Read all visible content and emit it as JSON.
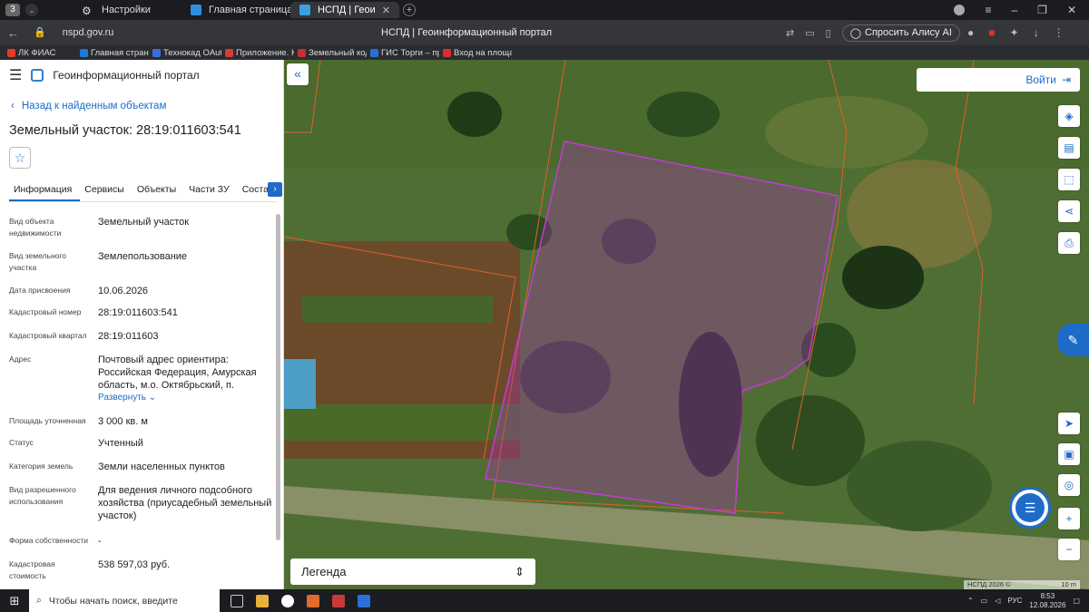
{
  "browser": {
    "workspace_badge": "3",
    "tabs": [
      {
        "label": "Настройки",
        "icon": "gear-icon"
      },
      {
        "label": "Главная страница",
        "icon": "site-favicon"
      },
      {
        "label": "НСПД | Геоинформаци",
        "icon": "nspd-favicon",
        "active": true
      }
    ],
    "url": "nspd.gov.ru",
    "page_title": "НСПД | Геоинформационный портал",
    "alice_button": "Спросить Алису AI",
    "bookmarks": [
      {
        "label": "ЛК ФИАС",
        "color": "#e03b2b"
      },
      {
        "label": "Главная страниц",
        "color": "#1d7ad9"
      },
      {
        "label": "Технокад OAuth",
        "color": "#3b6fd8"
      },
      {
        "label": "Приложение. Кла",
        "color": "#d83b3b"
      },
      {
        "label": "Земельный кодек",
        "color": "#c43030"
      },
      {
        "label": "ГИС Торги – прод",
        "color": "#2d6fd8"
      },
      {
        "label": "Вход на площадк",
        "color": "#d83030"
      }
    ]
  },
  "portal": {
    "title": "Геоинформационный портал",
    "back_link": "Назад к найденным объектам",
    "object_title": "Земельный участок: 28:19:011603:541",
    "tabs": [
      "Информация",
      "Сервисы",
      "Объекты",
      "Части ЗУ",
      "Состав"
    ],
    "fields": [
      {
        "key": "Вид объекта недвижимости",
        "value": "Земельный участок"
      },
      {
        "key": "Вид земельного участка",
        "value": "Землепользование"
      },
      {
        "key": "Дата присвоения",
        "value": "10.06.2026"
      },
      {
        "key": "Кадастровый номер",
        "value": "28:19:011603:541"
      },
      {
        "key": "Кадастровый квартал",
        "value": "28:19:011603"
      },
      {
        "key": "Адрес",
        "value": "Почтовый адрес ориентира: Российская Федерация, Амурская область, м.о. Октябрьский, п."
      },
      {
        "key": "Площадь уточненная",
        "value": "3 000 кв. м"
      },
      {
        "key": "Статус",
        "value": "Учтенный"
      },
      {
        "key": "Категория земель",
        "value": "Земли населенных пунктов"
      },
      {
        "key": "Вид разрешенного использования",
        "value": "Для ведения личного подсобного хозяйства (приусадебный земельный участок)"
      },
      {
        "key": "Форма собственности",
        "value": "-"
      },
      {
        "key": "Кадастровая стоимость",
        "value": "538 597,03 руб."
      }
    ],
    "expand_label": "Развернуть"
  },
  "map": {
    "login_label": "Войти",
    "legend_label": "Легенда",
    "copyright": "НСПД 2026 ©",
    "scale": "10 m",
    "parcel_color": "#c43bd0",
    "boundary_color": "#e0602a"
  },
  "taskbar": {
    "search_placeholder": "Чтобы начать поиск, введите",
    "lang": "РУС",
    "time": "8:53",
    "date": "12.08.2026"
  }
}
